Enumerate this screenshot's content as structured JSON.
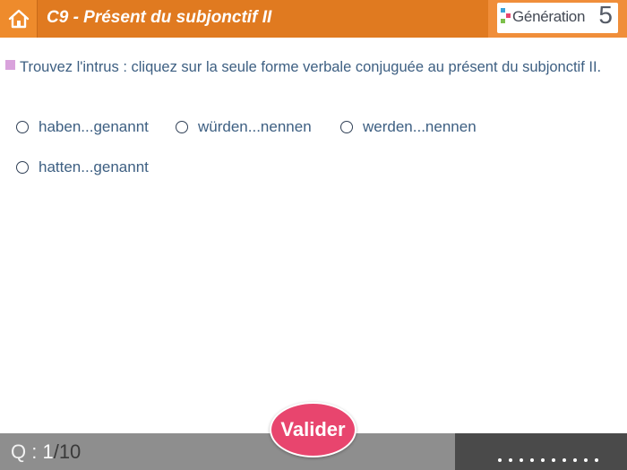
{
  "header": {
    "title": "C9 - Présent du subjonctif II",
    "home_icon": "home-icon",
    "brand": {
      "text": "Génération",
      "number": "5"
    }
  },
  "question": {
    "text": "Trouvez l'intrus : cliquez sur la seule forme verbale conjuguée au présent du subjonctif II."
  },
  "choices": [
    {
      "label": "haben...genannt",
      "selected": false
    },
    {
      "label": "würden...nennen",
      "selected": false
    },
    {
      "label": "werden...nennen",
      "selected": false
    },
    {
      "label": "hatten...genannt",
      "selected": false
    }
  ],
  "footer": {
    "counter_prefix": "Q : ",
    "current": "1",
    "total": "/10",
    "page_dots": 10
  },
  "actions": {
    "submit_label": "Valider"
  },
  "colors": {
    "header_orange": "#e07a20",
    "accent_pink": "#e8456e",
    "bullet_pink": "#d9a2dc",
    "text_blue": "#3d5f82",
    "footer_grey": "#8e8e8e",
    "footer_dark": "#4a4a4a"
  }
}
